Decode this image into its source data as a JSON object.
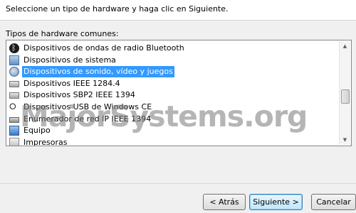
{
  "header": {
    "instruction": "Seleccione un tipo de hardware y haga clic en Siguiente."
  },
  "hardware_list": {
    "label": "Tipos de hardware comunes:",
    "items": [
      {
        "label": "Dispositivos de ondas de radio Bluetooth",
        "icon": "bluetooth-icon",
        "selected": false
      },
      {
        "label": "Dispositivos de sistema",
        "icon": "system-device-icon",
        "selected": false
      },
      {
        "label": "Dispositivos de sonido, vídeo y juegos",
        "icon": "sound-device-icon",
        "selected": true
      },
      {
        "label": "Dispositivos IEEE 1284.4",
        "icon": "ieee-device-icon",
        "selected": false
      },
      {
        "label": "Dispositivos SBP2 IEEE 1394",
        "icon": "sbp2-device-icon",
        "selected": false
      },
      {
        "label": "Dispositivos USB de Windows CE",
        "icon": "usb-icon",
        "selected": false
      },
      {
        "label": "Enumerador de red IP IEEE 1394",
        "icon": "network-enumerator-icon",
        "selected": false
      },
      {
        "label": "Equipo",
        "icon": "computer-icon",
        "selected": false
      },
      {
        "label": "Impresoras",
        "icon": "printer-icon",
        "selected": false
      }
    ],
    "scroll_position": 0.55
  },
  "watermark": {
    "text": "MajorSystems.org"
  },
  "buttons": {
    "back": "< Atrás",
    "next": "Siguiente >",
    "cancel": "Cancelar"
  },
  "colors": {
    "selection": "#3399ff",
    "background": "#f0f0f0"
  }
}
